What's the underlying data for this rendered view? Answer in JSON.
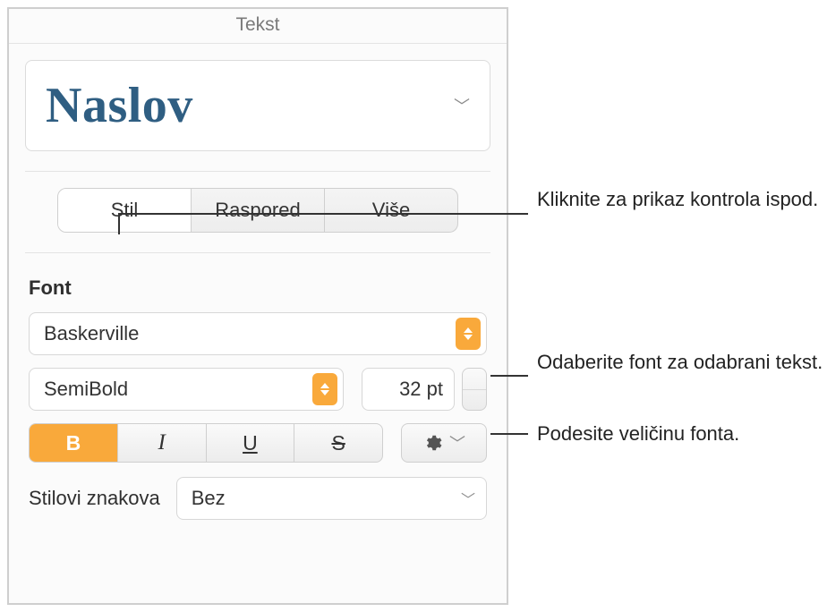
{
  "panel": {
    "title": "Tekst",
    "paragraph_style": "Naslov",
    "tabs": [
      "Stil",
      "Raspored",
      "Više"
    ],
    "active_tab": 0,
    "font_section_label": "Font",
    "font_family": "Baskerville",
    "font_weight": "SemiBold",
    "font_size_display": "32 pt",
    "format_buttons": {
      "bold": "B",
      "italic": "I",
      "underline": "U",
      "strike": "S"
    },
    "bold_active": true,
    "char_style_label": "Stilovi znakova",
    "char_style_value": "Bez"
  },
  "callouts": {
    "tabs": "Kliknite za prikaz kontrola ispod.",
    "font_family": "Odaberite font za odabrani tekst.",
    "font_size": "Podesite veličinu fonta."
  }
}
